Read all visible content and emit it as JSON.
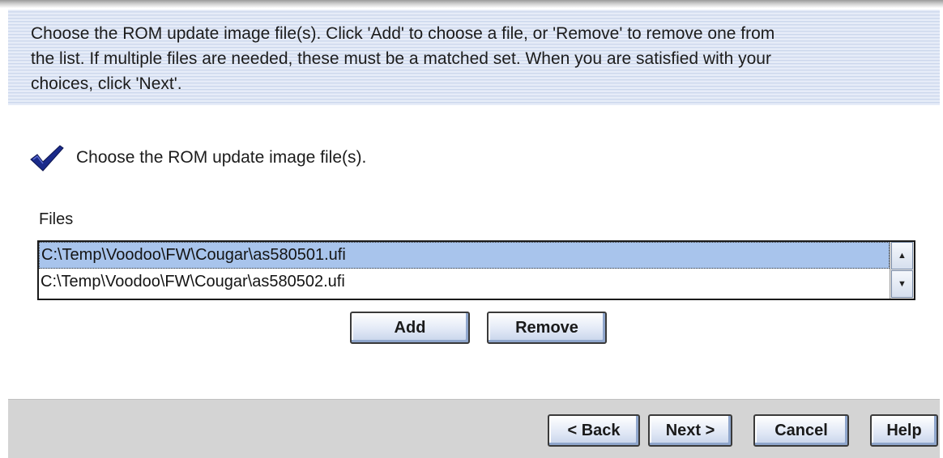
{
  "instructions": {
    "line1": "Choose the ROM update image file(s).  Click 'Add' to choose a file, or 'Remove' to remove one from",
    "line2": "the list.  If multiple files are needed, these must be a matched set.  When you are satisfied with your",
    "line3": "choices, click 'Next'."
  },
  "step": {
    "icon": "checkmark-icon",
    "label": "Choose the ROM update image file(s).",
    "status": "complete"
  },
  "files": {
    "label": "Files",
    "items": [
      {
        "path": "C:\\Temp\\Voodoo\\FW\\Cougar\\as580501.ufi",
        "selected": true
      },
      {
        "path": "C:\\Temp\\Voodoo\\FW\\Cougar\\as580502.ufi",
        "selected": false
      }
    ],
    "scroll_up_icon": "▲",
    "scroll_down_icon": "▼"
  },
  "actions": {
    "add_label": "Add",
    "remove_label": "Remove"
  },
  "footer": {
    "back_label": "< Back",
    "next_label": "Next >",
    "cancel_label": "Cancel",
    "help_label": "Help"
  },
  "colors": {
    "instruction_bg": "#dde5f4",
    "selection": "#a8c4ec",
    "footer_bg": "#d4d4d4",
    "checkmark": "#1a2a8a"
  }
}
